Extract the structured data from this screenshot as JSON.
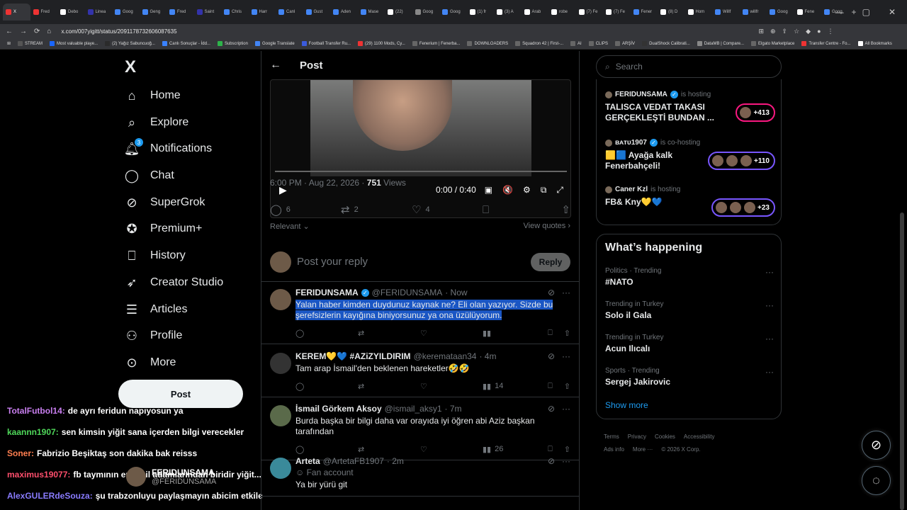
{
  "browser": {
    "tabs": [
      "X",
      "Fred",
      "Debo",
      "Linea",
      "Goog",
      "Geng",
      "Fred",
      "Saint",
      "Chris",
      "Harr",
      "Canl",
      "Gust",
      "Aden",
      "Mase",
      "(22)",
      "Goog",
      "Goog",
      "(1) fr",
      "(3) A",
      "Arab",
      "robe",
      "(7) Fe",
      "(7) Fe",
      "Fener",
      "(8) D",
      "Hom",
      "Willf",
      "willfr",
      "Goog",
      "Fene",
      "Goog"
    ],
    "url": "x.com/007yigitt/status/2091178732606087635",
    "bookmarks": [
      "STREAM",
      "Most valuable playe...",
      "(2) Yağız Sabuncuoğ...",
      "Canlı Sonuçlar - İdd...",
      "Subscription",
      "Google Translate",
      "Football Transfer Ru...",
      "(29) 1100 Mods, Cy...",
      "Fenerium | Fenerba...",
      "DOWNLOADERS",
      "Squadron 42 | First-...",
      "AI",
      "CLIPS",
      "ARŞİV",
      "DualShock Calibrati...",
      "DataMB | Compare...",
      "Elgato Marketplace",
      "Transfer Centre - Fo...",
      "All Bookmarks"
    ]
  },
  "sidebar": {
    "logo": "X",
    "items": [
      {
        "label": "Home",
        "icon": "home-icon"
      },
      {
        "label": "Explore",
        "icon": "search-icon"
      },
      {
        "label": "Notifications",
        "icon": "bell-icon",
        "badge": "3"
      },
      {
        "label": "Chat",
        "icon": "chat-icon"
      },
      {
        "label": "SuperGrok",
        "icon": "grok-icon"
      },
      {
        "label": "Premium+",
        "icon": "premium-icon"
      },
      {
        "label": "History",
        "icon": "bookmark-icon"
      },
      {
        "label": "Creator Studio",
        "icon": "rocket-icon"
      },
      {
        "label": "Articles",
        "icon": "articles-icon"
      },
      {
        "label": "Profile",
        "icon": "profile-icon"
      },
      {
        "label": "More",
        "icon": "more-icon"
      }
    ],
    "post_button": "Post"
  },
  "stream_chat": [
    {
      "user": "TotalFutbol14:",
      "color": "#c97ff0",
      "msg": "de ayrı feridun napıyosun ya"
    },
    {
      "user": "kaannn1907:",
      "color": "#4fd85a",
      "msg": "sen kimsin yiğit sana içerden bilgi verecekler"
    },
    {
      "user": "Soner:",
      "color": "#ff7f50",
      "msg": "Fabrizio Beşiktaş son dakika bak reisss"
    },
    {
      "user": "maximus19077:",
      "color": "#ff4f6d",
      "msg": "fb taymının en rezil adamlarından biridir yiğit..."
    },
    {
      "user": "AlexGULERdeSouza:",
      "color": "#8a7cff",
      "msg": "şu trabzonluyu paylaşmayın abicim etkileşim için"
    }
  ],
  "overlay_user": {
    "name": "FERIDUNSAMA",
    "handle": "@FERIDUNSAMA"
  },
  "main": {
    "header_title": "Post",
    "video": {
      "time": "0:00 / 0:40"
    },
    "meta": {
      "timestamp": "6:00 PM · Aug 22, 2026 · ",
      "views_count": "751",
      "views_label": " Views"
    },
    "actions": {
      "replies": "6",
      "reposts": "2",
      "likes": "4"
    },
    "sort_label": "Relevant",
    "view_quotes": "View quotes",
    "reply_placeholder": "Post your reply",
    "reply_button": "Reply"
  },
  "replies": [
    {
      "name": "FERIDUNSAMA",
      "verified": true,
      "handle": "@FERIDUNSAMA",
      "time": "· Now",
      "text": "Yalan haber kimden duydunuz kaynak ne? Eli olan yazıyor. Sizde bu şerefsizlerin kayığına biniyorsunuz ya ona üzülüyorum.",
      "views": "",
      "selected": true
    },
    {
      "name": "KEREM💛💙 #AZiZYILDIRIM",
      "verified": false,
      "handle": "@keremataan34",
      "time": "· 4m",
      "text": "Tam arap İsmail'den beklenen hareketler🤣🤣",
      "views": "14",
      "selected": false
    },
    {
      "name": "İsmail Görkem Aksoy",
      "verified": false,
      "handle": "@ismail_aksy1",
      "time": "· 7m",
      "text": "Burda başka bir bilgi daha var orayıda iyi öğren abi Aziz başkan tarafından",
      "views": "26",
      "selected": false
    },
    {
      "name": "Arteta",
      "verified": false,
      "handle": "@ArtetaFB1907",
      "time": "· 2m",
      "fan": "Fan account",
      "text": "Ya bir yürü git",
      "views": "",
      "selected": false
    }
  ],
  "right": {
    "search_placeholder": "Search",
    "spaces": [
      {
        "host": "FERIDUNSAMA",
        "role": "is hosting",
        "title": "TALISCA VEDAT TAKASI GERÇEKLEŞTİ BUNDAN ...",
        "count": "+413",
        "color": "#f91880"
      },
      {
        "host": "ʙᴀᴛᴜ1907",
        "role": "is co-hosting",
        "title": "🟨🟦 Ayağa kalk Fenerbahçeli!",
        "count": "+110",
        "color": "#7856ff"
      },
      {
        "host": "Caner Kzl",
        "role": "is hosting",
        "title": "FB& Kny💛💙",
        "count": "+23",
        "color": "#7856ff"
      }
    ],
    "happening_title": "What’s happening",
    "trends": [
      {
        "context": "Politics · Trending",
        "name": "#NATO"
      },
      {
        "context": "Trending in Turkey",
        "name": "Solo il Gala"
      },
      {
        "context": "Trending in Turkey",
        "name": "Acun Ilıcalı"
      },
      {
        "context": "Sports · Trending",
        "name": "Sergej Jakirovic"
      }
    ],
    "show_more": "Show more",
    "footer": [
      "Terms",
      "Privacy",
      "Cookies",
      "Accessibility",
      "Ads info",
      "More ···",
      "© 2026 X Corp."
    ]
  }
}
